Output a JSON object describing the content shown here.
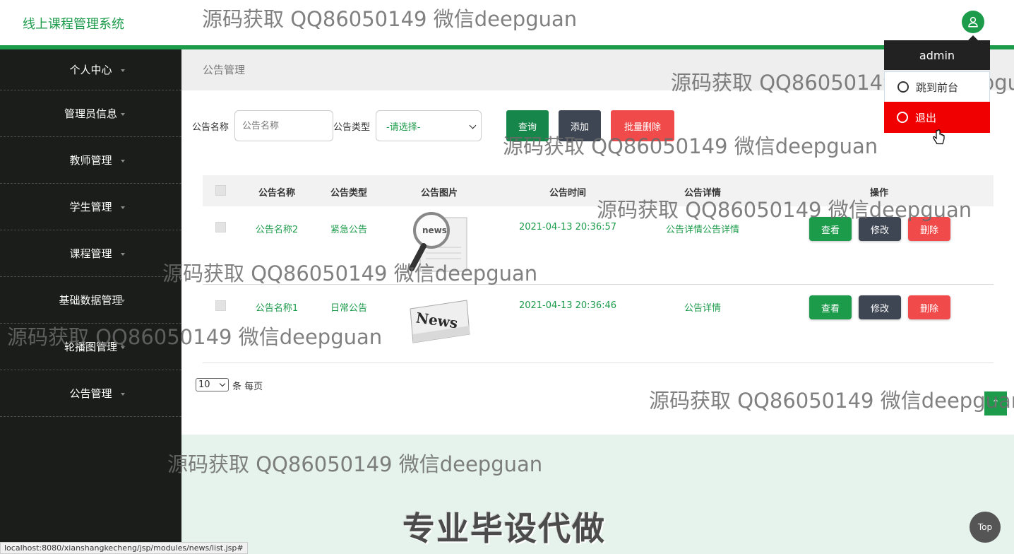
{
  "app": {
    "title": "线上课程管理系统"
  },
  "user": {
    "name": "admin"
  },
  "user_menu": {
    "front": "跳到前台",
    "logout": "退出"
  },
  "sidebar": {
    "items": [
      {
        "label": "个人中心"
      },
      {
        "label": "管理员信息"
      },
      {
        "label": "教师管理"
      },
      {
        "label": "学生管理"
      },
      {
        "label": "课程管理"
      },
      {
        "label": "基础数据管理"
      },
      {
        "label": "轮播图管理"
      },
      {
        "label": "公告管理"
      }
    ]
  },
  "breadcrumb": "公告管理",
  "search": {
    "name_label": "公告名称",
    "name_placeholder": "公告名称",
    "type_label": "公告类型",
    "type_value": "-请选择-",
    "query_label": "查询",
    "add_label": "添加",
    "batch_delete_label": "批量删除"
  },
  "table": {
    "headers": [
      "公告名称",
      "公告类型",
      "公告图片",
      "公告时间",
      "公告详情",
      "操作"
    ],
    "rows": [
      {
        "name": "公告名称2",
        "type": "紧急公告",
        "image": "news-magnifier",
        "time": "2021-04-13 20:36:57",
        "detail": "公告详情公告详情"
      },
      {
        "name": "公告名称1",
        "type": "日常公告",
        "image": "news-paper",
        "time": "2021-04-13 20:36:46",
        "detail": "公告详情"
      }
    ],
    "actions": {
      "view": "查看",
      "edit": "修改",
      "delete": "删除"
    }
  },
  "pager": {
    "page_size": "10",
    "suffix": "条 每页"
  },
  "footer": {
    "slogan": "专业毕设代做",
    "top_label": "Top",
    "side_button": "↑"
  },
  "status_url": "localhost:8080/xianshangkecheng/jsp/modules/news/list.jsp#",
  "watermark": "源码获取 QQ86050149 微信deepguan",
  "colors": {
    "accent": "#1c9b4b",
    "sidebar": "#1a1d1a",
    "danger": "#f04a4a",
    "dark_btn": "#3f4653",
    "logout": "#f00000"
  }
}
